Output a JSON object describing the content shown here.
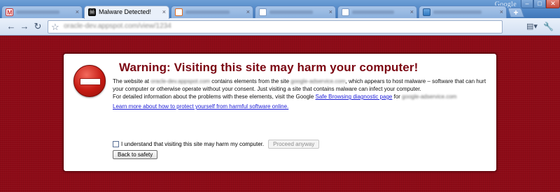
{
  "window": {
    "brand": "Google",
    "buttons": {
      "minimize": "–",
      "maximize": "□",
      "close": "✕"
    }
  },
  "tabs": [
    {
      "id": "mail",
      "label": "",
      "icon": "gmail-icon",
      "active": false
    },
    {
      "id": "malware",
      "label": "Malware Detected!",
      "icon": "skull-icon",
      "active": true
    },
    {
      "id": "yc",
      "label": "",
      "icon": "y-icon",
      "active": false
    },
    {
      "id": "page1",
      "label": "",
      "icon": "page-icon",
      "active": false
    },
    {
      "id": "page2",
      "label": "",
      "icon": "page-icon",
      "active": false
    },
    {
      "id": "img",
      "label": "",
      "icon": "image-icon",
      "active": false
    }
  ],
  "toolbar": {
    "back": "←",
    "forward": "→",
    "reload": "↻",
    "star": "☆",
    "url": "oracle-dev.appspot.com/view/1234",
    "page_menu": "▤▾",
    "wrench_menu": "🔧▾"
  },
  "warning": {
    "headline": "Warning: Visiting this site may harm your computer!",
    "p1_a": "The website at",
    "p1_site": "oracle-dev.appspot.com",
    "p1_b": "contains elements from the site",
    "p1_source": "google-adservice.com",
    "p1_c": ", which appears to host malware – software that can hurt your computer or otherwise operate without your consent. Just visiting a site that contains malware can infect your computer.",
    "p2_a": "For detailed information about the problems with these elements, visit the Google",
    "p2_link": "Safe Browsing diagnostic page",
    "p2_b": "for",
    "p2_site": "google-adservice.com",
    "learn_more": "Learn more about how to protect yourself from harmful software online.",
    "ack_label": "I understand that visiting this site may harm my computer.",
    "proceed": "Proceed anyway",
    "back": "Back to safety"
  }
}
